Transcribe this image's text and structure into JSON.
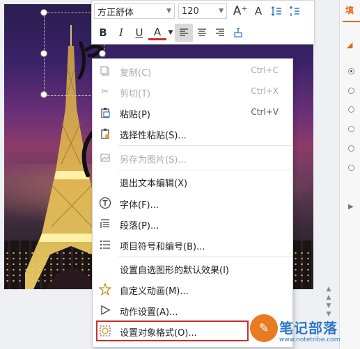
{
  "toolbar": {
    "font_name": "方正舒体",
    "font_size": "120",
    "grow_font": "A⁺",
    "shrink_font": "A",
    "bold": "B",
    "italic": "I",
    "underline": "U",
    "font_color": "A"
  },
  "context_menu": {
    "items": [
      {
        "label": "复制(C)",
        "shortcut": "Ctrl+C",
        "enabled": false,
        "icon": "copy-icon"
      },
      {
        "label": "剪切(T)",
        "shortcut": "Ctrl+X",
        "enabled": false,
        "icon": "scissors-icon"
      },
      {
        "label": "粘贴(P)",
        "shortcut": "Ctrl+V",
        "enabled": true,
        "icon": "paste-icon"
      },
      {
        "label": "选择性粘贴(S)...",
        "shortcut": "",
        "enabled": true,
        "icon": "paste-special-icon"
      },
      {
        "label": "另存为图片(S)...",
        "shortcut": "",
        "enabled": false,
        "icon": "save-image-icon"
      },
      {
        "label": "退出文本编辑(X)",
        "shortcut": "",
        "enabled": true,
        "icon": ""
      },
      {
        "label": "字体(F)...",
        "shortcut": "",
        "enabled": true,
        "icon": "font-icon"
      },
      {
        "label": "段落(P)...",
        "shortcut": "",
        "enabled": true,
        "icon": "paragraph-icon"
      },
      {
        "label": "项目符号和编号(B)...",
        "shortcut": "",
        "enabled": true,
        "icon": "bullets-icon"
      },
      {
        "label": "设置自选图形的默认效果(I)",
        "shortcut": "",
        "enabled": true,
        "icon": ""
      },
      {
        "label": "自定义动画(M)...",
        "shortcut": "",
        "enabled": true,
        "icon": "star-animation-icon"
      },
      {
        "label": "动作设置(A)...",
        "shortcut": "",
        "enabled": true,
        "icon": "play-icon"
      },
      {
        "label": "设置对象格式(O)...",
        "shortcut": "",
        "enabled": true,
        "icon": "format-object-icon"
      }
    ]
  },
  "right_pane": {
    "tab_label": "填"
  },
  "watermark": {
    "title": "笔记部落",
    "url": "www.notetribe.com"
  },
  "colors": {
    "accent": "#e06a18",
    "highlight_border": "#d42a2a"
  }
}
